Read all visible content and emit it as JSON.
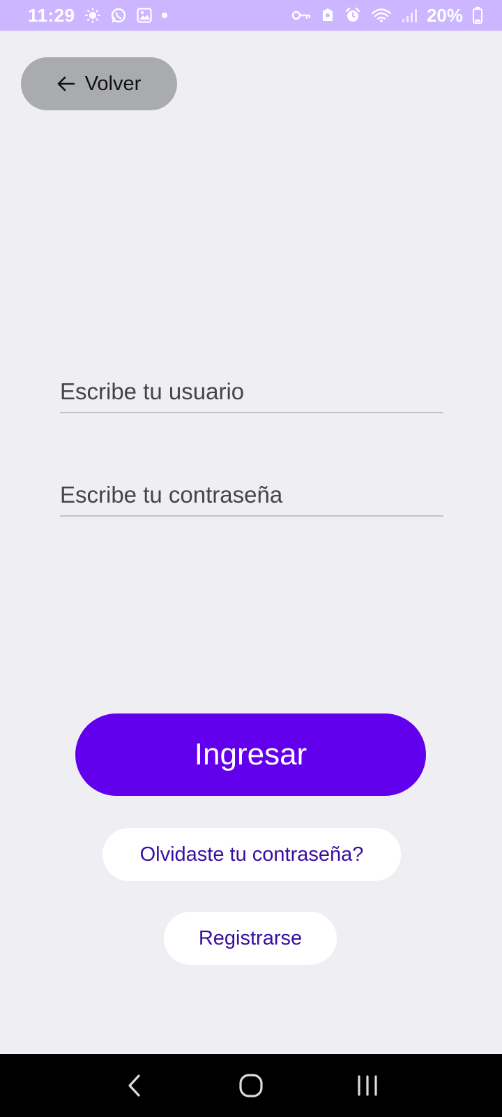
{
  "status_bar": {
    "time": "11:29",
    "battery_percent": "20%",
    "left_icons": [
      "brightness-icon",
      "whatsapp-icon",
      "gallery-icon",
      "dot-icon"
    ],
    "right_icons": [
      "vpn-key-icon",
      "secure-folder-icon",
      "alarm-icon",
      "wifi-icon",
      "signal-icon",
      "battery-icon"
    ]
  },
  "header": {
    "back_label": "Volver"
  },
  "form": {
    "username_placeholder": "Escribe tu usuario",
    "username_value": "",
    "password_placeholder": "Escribe tu contraseña",
    "password_value": ""
  },
  "actions": {
    "login_label": "Ingresar",
    "forgot_label": "Olvidaste tu contraseña?",
    "register_label": "Registrarse"
  },
  "colors": {
    "status_bar": "#cbb6ff",
    "background": "#efeff3",
    "primary": "#6200ee",
    "back_button": "#a9abaf",
    "link_text": "#3a0fa0"
  },
  "nav_bar": {
    "buttons": [
      "back-nav-icon",
      "home-nav-icon",
      "recents-nav-icon"
    ]
  }
}
